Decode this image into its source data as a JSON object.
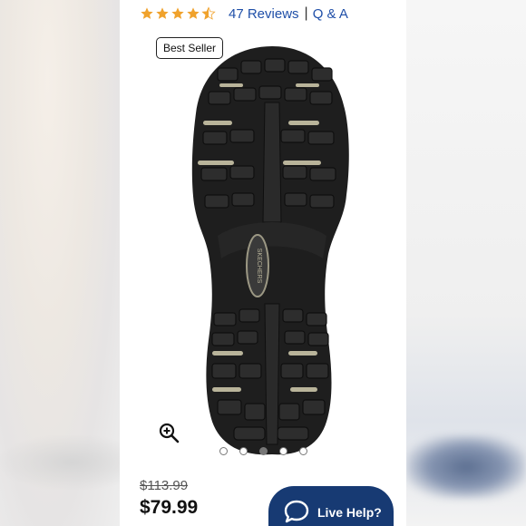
{
  "rating": {
    "stars_value": 4.5,
    "reviews_label": "47 Reviews",
    "separator": "|",
    "qa_label": "Q & A"
  },
  "badge": {
    "label": "Best Seller"
  },
  "product_image": {
    "icon": "shoe-sole-image",
    "brand_text": "SKECHERS"
  },
  "carousel": {
    "count": 5,
    "active_index": 2
  },
  "pricing": {
    "original_price": "$113.99",
    "sale_price": "$79.99"
  },
  "live_help": {
    "label": "Live Help?",
    "icon": "chat-bubble-icon"
  },
  "colors": {
    "link_blue": "#1f4fa8",
    "star_orange": "#f0a22c",
    "help_navy": "#173a73"
  }
}
